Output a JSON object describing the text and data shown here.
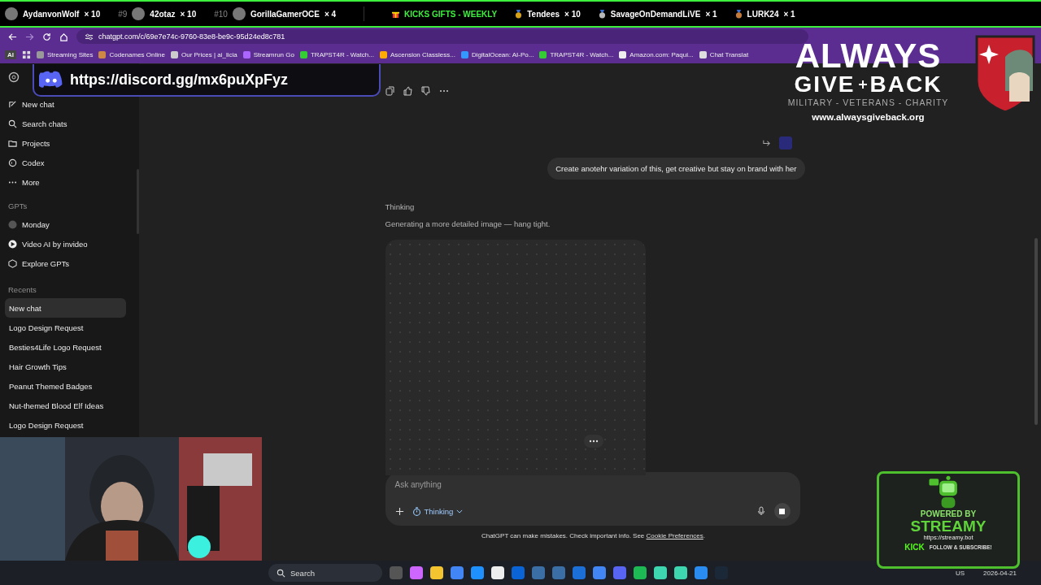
{
  "leaderboard": {
    "top": [
      {
        "name": "AydanvonWolf",
        "count": "× 10"
      },
      {
        "rank": "#9",
        "name": "42otaz",
        "count": "× 10"
      },
      {
        "rank": "#10",
        "name": "GorillaGamerOCE",
        "count": "× 4"
      }
    ],
    "banner": "KICKS GIFTS - WEEKLY",
    "weekly": [
      {
        "name": "Tendees",
        "count": "× 10",
        "color": "#d4a017"
      },
      {
        "name": "SavageOnDemandLiVE",
        "count": "× 1",
        "color": "#b8b8b8"
      },
      {
        "name": "LURK24",
        "count": "× 1",
        "color": "#c27a3a"
      }
    ]
  },
  "browser": {
    "profile_badge": "AI",
    "address": "chatgpt.com/c/69e7e74c-9760-83e8-be9c-95d24ed8c781",
    "bookmarks": [
      "Streaming Sites",
      "Codenames Online",
      "Our Prices | ai_licia",
      "Streamrun Go",
      "TRAPST4R - Watch...",
      "Ascension Classless...",
      "DigitalOcean: AI-Po...",
      "TRAPST4R - Watch...",
      "Amazon.com: Paqui...",
      "Chat Translat"
    ]
  },
  "discord_banner": {
    "link": "https://discord.gg/mx6puXpFyz"
  },
  "sidebar": {
    "nav": [
      "New chat",
      "Search chats",
      "Projects",
      "Codex",
      "More"
    ],
    "gpts_heading": "GPTs",
    "gpts": [
      "Monday",
      "Video AI by invideo",
      "Explore GPTs"
    ],
    "recents_heading": "Recents",
    "recents": [
      {
        "title": "New chat",
        "selected": true
      },
      {
        "title": "Logo Design Request",
        "selected": false
      },
      {
        "title": "Besties4Life Logo Request",
        "selected": false
      },
      {
        "title": "Hair Growth Tips",
        "selected": false
      },
      {
        "title": "Peanut Themed Badges",
        "selected": false
      },
      {
        "title": "Nut-themed Blood Elf Ideas",
        "selected": false
      },
      {
        "title": "Logo Design Request",
        "selected": false
      }
    ]
  },
  "chat": {
    "user_message": "Create anotehr variation of this, get creative but stay on brand with her",
    "status": "Thinking",
    "status_detail": "Generating a more detailed image — hang tight."
  },
  "composer": {
    "placeholder": "Ask anything",
    "mode": "Thinking"
  },
  "disclaimer": {
    "text": "ChatGPT can make mistakes. Check important info. See ",
    "link": "Cookie Preferences",
    "end": "."
  },
  "taskbar": {
    "search_placeholder": "Search",
    "language": "US",
    "date": "2026-04-21"
  },
  "overlay_logo": {
    "line1": "ALWAYS",
    "line2": [
      "GIVE",
      "BACK"
    ],
    "tagline": "MILITARY - VETERANS - CHARITY",
    "url": "www.alwaysgiveback.org"
  },
  "streamy_badge": {
    "powered": "POWERED BY",
    "name": "STREAMY",
    "url": "https://streamy.bot",
    "platform": "KICK",
    "cta": "FOLLOW & SUBSCRIBE!"
  }
}
